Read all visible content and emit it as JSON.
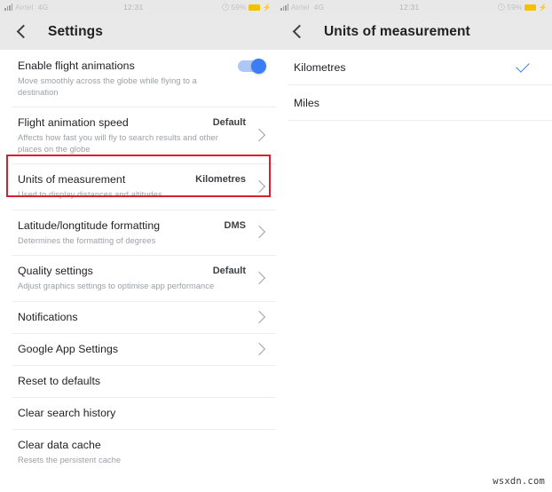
{
  "status_bar": {
    "carrier": "Airtel",
    "network": "4G",
    "time": "12:31",
    "battery_percent": "59%",
    "signal_icon": "signal-bars-icon",
    "alarm_icon": "alarm-clock-icon",
    "battery_icon": "battery-icon",
    "charging_icon": "lightning-bolt-icon"
  },
  "left_screen": {
    "appbar": {
      "back_icon": "back-chevron-icon",
      "title": "Settings"
    },
    "rows": [
      {
        "title": "Enable flight animations",
        "subtitle": "Move smoothly across the globe while flying to a destination",
        "value": "",
        "control": "toggle",
        "toggle_on": true
      },
      {
        "title": "Flight animation speed",
        "subtitle": "Affects how fast you will fly to search results and other places on the globe",
        "value": "Default",
        "control": "chevron"
      },
      {
        "title": "Units of measurement",
        "subtitle": "Used to display distances and altitudes",
        "value": "Kilometres",
        "control": "chevron",
        "highlighted": true
      },
      {
        "title": "Latitude/longtitude formatting",
        "subtitle": "Determines the formatting of degrees",
        "value": "DMS",
        "control": "chevron"
      },
      {
        "title": "Quality settings",
        "subtitle": "Adjust graphics settings to optimise app performance",
        "value": "Default",
        "control": "chevron"
      },
      {
        "title": "Notifications",
        "subtitle": "",
        "value": "",
        "control": "chevron"
      },
      {
        "title": "Google App Settings",
        "subtitle": "",
        "value": "",
        "control": "chevron"
      },
      {
        "title": "Reset to defaults",
        "subtitle": "",
        "value": "",
        "control": "none"
      },
      {
        "title": "Clear search history",
        "subtitle": "",
        "value": "",
        "control": "none"
      },
      {
        "title": "Clear data cache",
        "subtitle": "Resets the persistent cache",
        "value": "",
        "control": "none"
      }
    ]
  },
  "right_screen": {
    "appbar": {
      "back_icon": "back-chevron-icon",
      "title": "Units of measurement"
    },
    "options": [
      {
        "label": "Kilometres",
        "selected": true,
        "check_icon": "checkmark-icon"
      },
      {
        "label": "Miles",
        "selected": false,
        "check_icon": ""
      }
    ]
  },
  "watermark": "wsxdn.com",
  "colors": {
    "accent_blue": "#3b7ef3",
    "toggle_track": "#aec7f6",
    "highlight_red": "#d72030",
    "appbar_gray": "#e9e9e9",
    "battery_yellow": "#f4c100"
  }
}
